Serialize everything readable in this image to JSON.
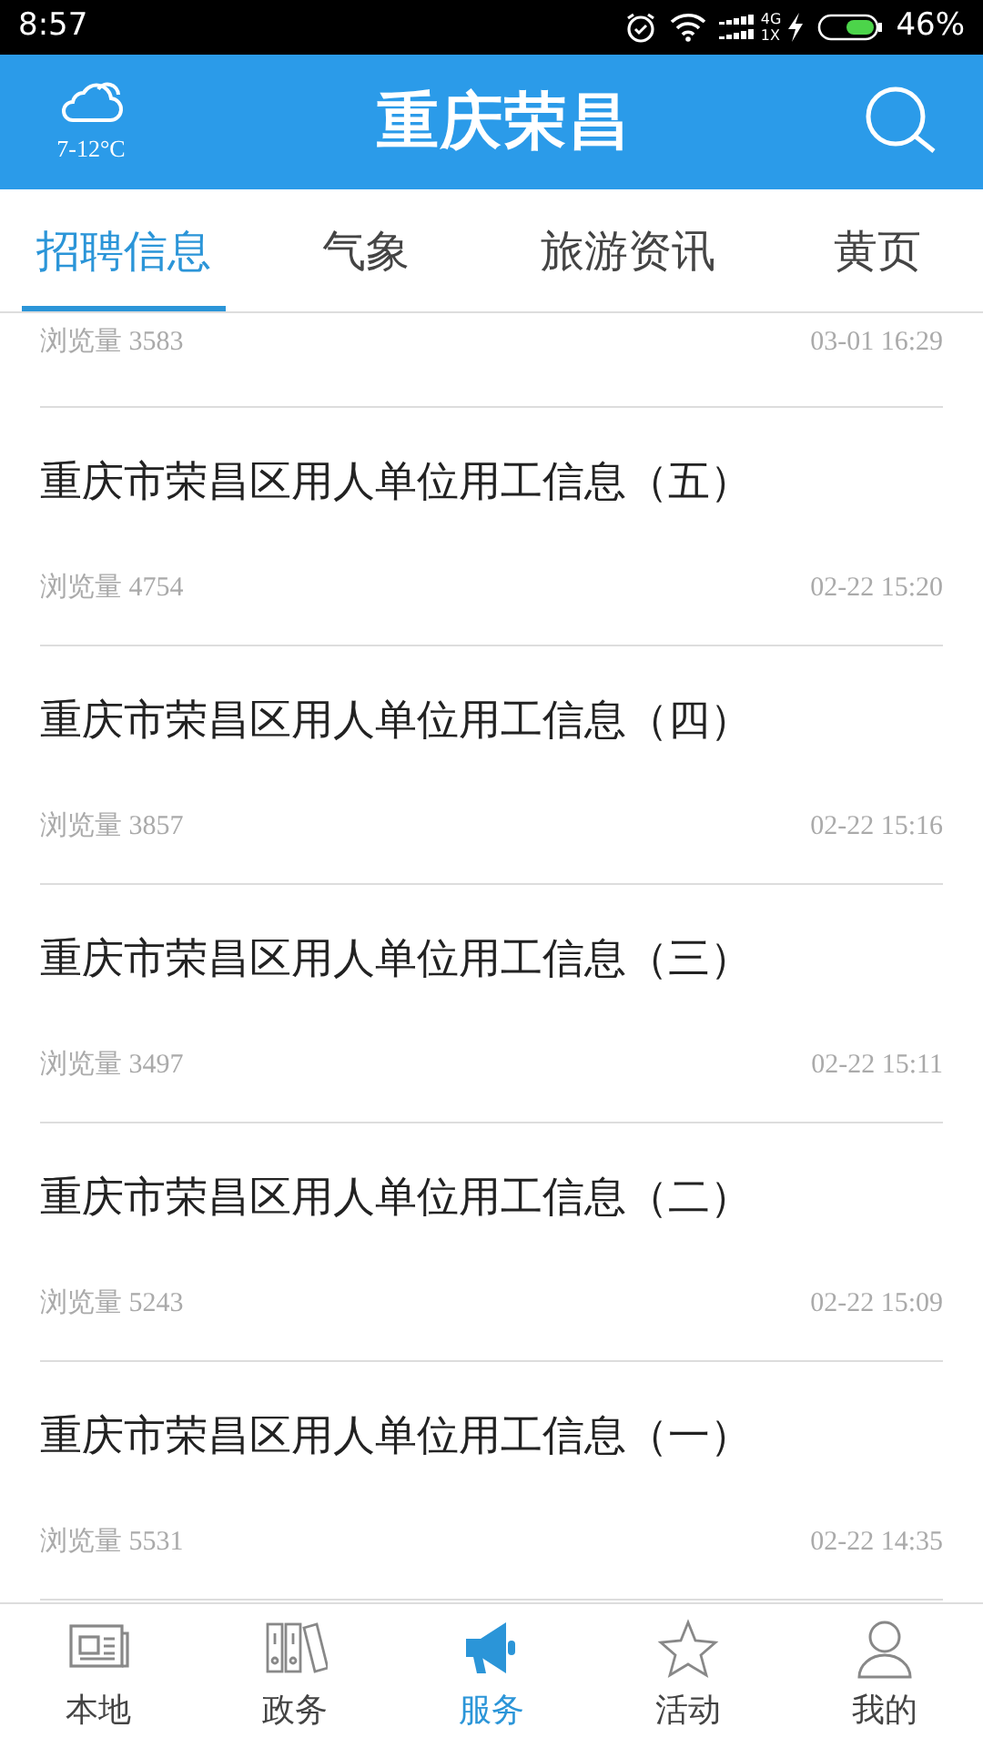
{
  "status_bar": {
    "time": "8:57",
    "network": "4G",
    "network_sub": "1X",
    "battery": "46%"
  },
  "header": {
    "weather": "7-12°C",
    "title": "重庆荣昌"
  },
  "tabs": [
    {
      "label": "招聘信息",
      "selected": true
    },
    {
      "label": "气象",
      "selected": false
    },
    {
      "label": "旅游资讯",
      "selected": false
    },
    {
      "label": "黄页",
      "selected": false
    }
  ],
  "articles": [
    {
      "views": "浏览量 3583",
      "date": "03-01 16:29"
    },
    {
      "title": "重庆市荣昌区用人单位用工信息（五）",
      "views": "浏览量 4754",
      "date": "02-22 15:20"
    },
    {
      "title": "重庆市荣昌区用人单位用工信息（四）",
      "views": "浏览量 3857",
      "date": "02-22 15:16"
    },
    {
      "title": "重庆市荣昌区用人单位用工信息（三）",
      "views": "浏览量 3497",
      "date": "02-22 15:11"
    },
    {
      "title": "重庆市荣昌区用人单位用工信息（二）",
      "views": "浏览量 5243",
      "date": "02-22 15:09"
    },
    {
      "title": "重庆市荣昌区用人单位用工信息（一）",
      "views": "浏览量 5531",
      "date": "02-22 14:35"
    }
  ],
  "bottom_nav": [
    {
      "label": "本地",
      "kind": "newspaper",
      "selected": false
    },
    {
      "label": "政务",
      "kind": "binders",
      "selected": false
    },
    {
      "label": "服务",
      "kind": "megaphone",
      "selected": true
    },
    {
      "label": "活动",
      "kind": "star",
      "selected": false
    },
    {
      "label": "我的",
      "kind": "person",
      "selected": false
    }
  ]
}
